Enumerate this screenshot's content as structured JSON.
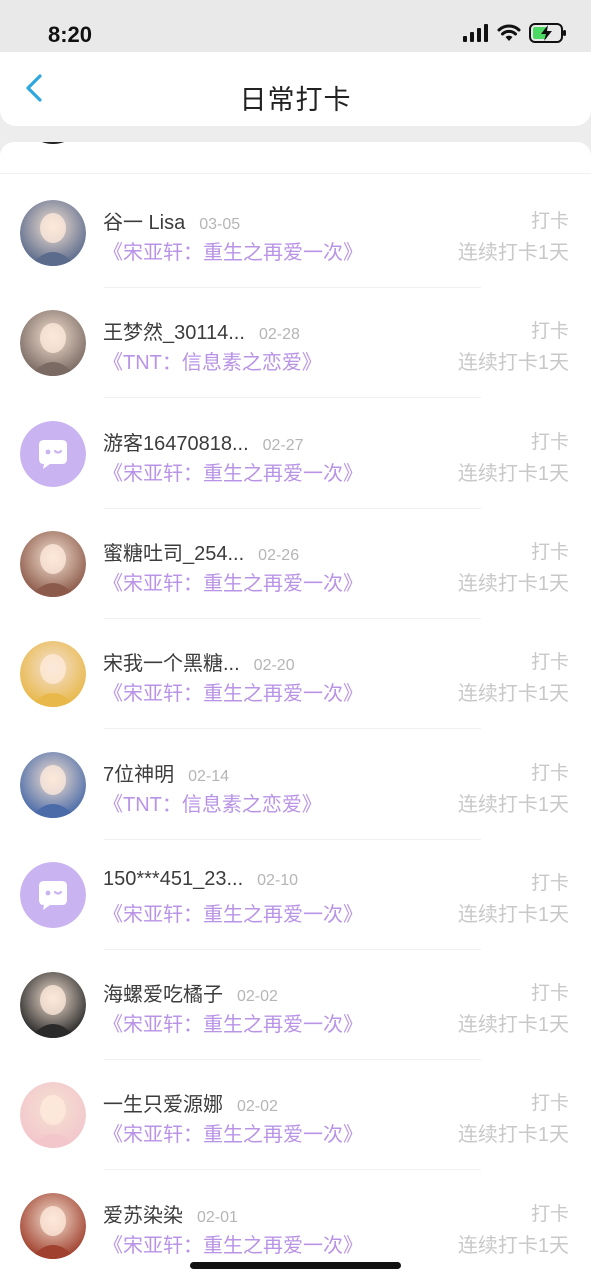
{
  "status_bar": {
    "time": "8:20",
    "icons": [
      "signal-icon",
      "wifi-icon",
      "battery-charging-icon"
    ]
  },
  "nav": {
    "back_icon": "chevron-left-icon",
    "title": "日常打卡",
    "accent_color": "#2ea7e0"
  },
  "colors": {
    "book_title": "#b994e6",
    "muted": "#c8c8c8",
    "name": "#3c3c3c"
  },
  "rows": [
    {
      "name": "谷一 Lisa",
      "date": "03-05",
      "book": "《宋亚轩：重生之再爱一次》",
      "checkin": "打卡",
      "streak": "连续打卡1天",
      "avatar": "photo-avatar"
    },
    {
      "name": "王梦然_30114...",
      "date": "02-28",
      "book": "《TNT：信息素之恋爱》",
      "checkin": "打卡",
      "streak": "连续打卡1天",
      "avatar": "photo-avatar"
    },
    {
      "name": "游客16470818...",
      "date": "02-27",
      "book": "《宋亚轩：重生之再爱一次》",
      "checkin": "打卡",
      "streak": "连续打卡1天",
      "avatar": "default-chat-avatar"
    },
    {
      "name": "蜜糖吐司_254...",
      "date": "02-26",
      "book": "《宋亚轩：重生之再爱一次》",
      "checkin": "打卡",
      "streak": "连续打卡1天",
      "avatar": "photo-avatar"
    },
    {
      "name": "宋我一个黑糖...",
      "date": "02-20",
      "book": "《宋亚轩：重生之再爱一次》",
      "checkin": "打卡",
      "streak": "连续打卡1天",
      "avatar": "photo-avatar"
    },
    {
      "name": "7位神明",
      "date": "02-14",
      "book": "《TNT：信息素之恋爱》",
      "checkin": "打卡",
      "streak": "连续打卡1天",
      "avatar": "photo-avatar"
    },
    {
      "name": "150***451_23...",
      "date": "02-10",
      "book": "《宋亚轩：重生之再爱一次》",
      "checkin": "打卡",
      "streak": "连续打卡1天",
      "avatar": "default-chat-avatar"
    },
    {
      "name": "海螺爱吃橘子",
      "date": "02-02",
      "book": "《宋亚轩：重生之再爱一次》",
      "checkin": "打卡",
      "streak": "连续打卡1天",
      "avatar": "photo-avatar"
    },
    {
      "name": "一生只爱源娜",
      "date": "02-02",
      "book": "《宋亚轩：重生之再爱一次》",
      "checkin": "打卡",
      "streak": "连续打卡1天",
      "avatar": "photo-avatar"
    },
    {
      "name": "爱苏染染",
      "date": "02-01",
      "book": "《宋亚轩：重生之再爱一次》",
      "checkin": "打卡",
      "streak": "连续打卡1天",
      "avatar": "photo-avatar"
    }
  ]
}
